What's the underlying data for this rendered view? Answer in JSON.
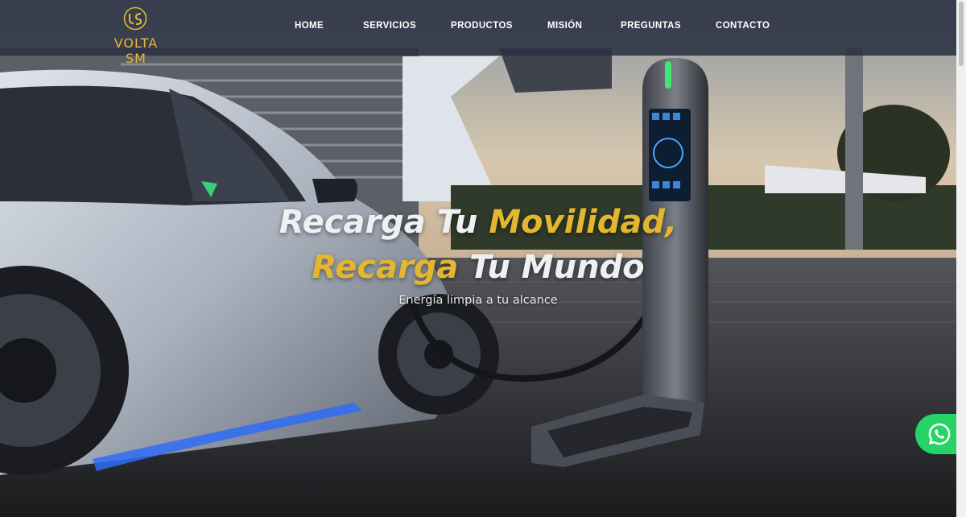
{
  "brand": {
    "name": "VOLTA SM",
    "accent_color": "#e4b630",
    "logo_icon": "vs-monogram-icon"
  },
  "nav": {
    "items": [
      {
        "label": "HOME"
      },
      {
        "label": "SERVICIOS"
      },
      {
        "label": "PRODUCTOS"
      },
      {
        "label": "MISIÓN"
      },
      {
        "label": "PREGUNTAS"
      },
      {
        "label": "CONTACTO"
      }
    ]
  },
  "hero": {
    "headline": {
      "part1": "Recarga Tu ",
      "part2": "Movilidad,",
      "part3": "Recarga",
      "part4": " Tu Mundo"
    },
    "subtitle": "Energía limpia a tu alcance",
    "background": "electric-car-charging-station-photo"
  },
  "whatsapp": {
    "icon": "whatsapp-icon",
    "color": "#25d366"
  }
}
